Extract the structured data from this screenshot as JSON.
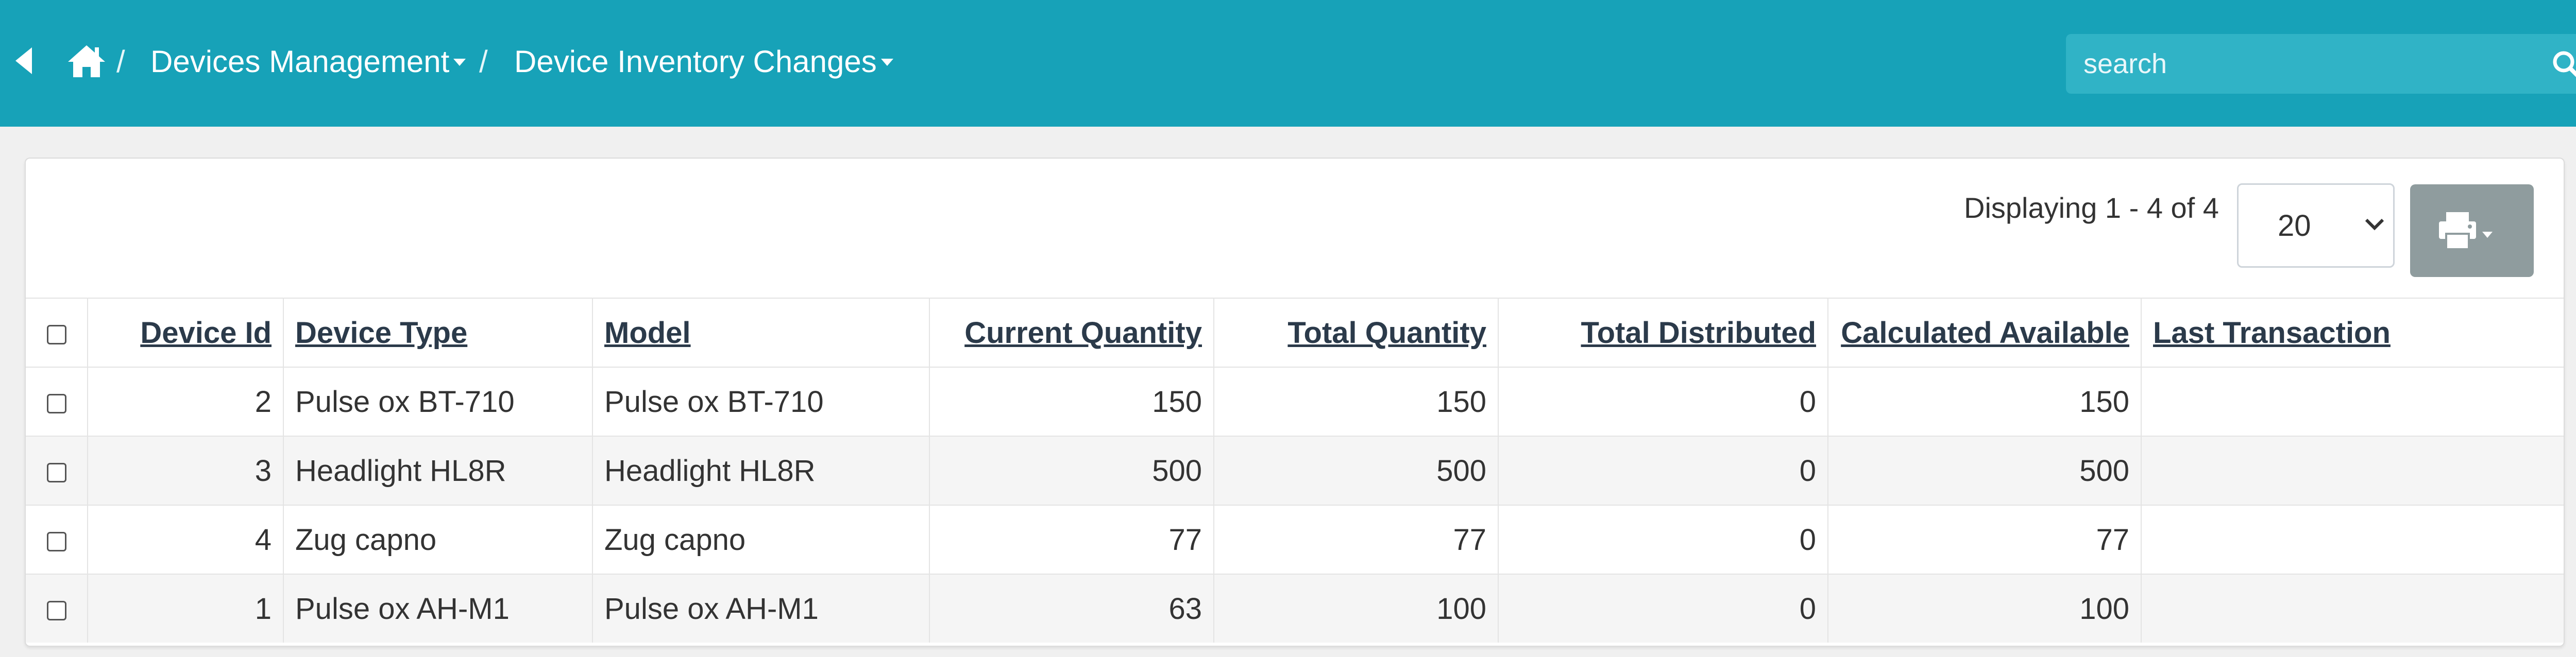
{
  "header": {
    "breadcrumb": {
      "home_icon": "home-icon",
      "items": [
        {
          "label": "Devices Management"
        },
        {
          "label": "Device Inventory Changes"
        }
      ],
      "separator": "/"
    },
    "search": {
      "placeholder": "search",
      "icon": "search-icon"
    },
    "colors": {
      "bar": "#17a2b8"
    }
  },
  "toolbar": {
    "displaying": "Displaying 1 - 4 of 4",
    "page_size": "20",
    "print_icon": "print-icon"
  },
  "table": {
    "columns": [
      "Device Id",
      "Device Type",
      "Model",
      "Current Quantity",
      "Total Quantity",
      "Total Distributed",
      "Calculated Available",
      "Last Transaction"
    ],
    "rows": [
      {
        "id": "2",
        "type": "Pulse ox BT-710",
        "model": "Pulse ox BT-710",
        "current": "150",
        "total": "150",
        "distributed": "0",
        "available": "150",
        "last": ""
      },
      {
        "id": "3",
        "type": "Headlight HL8R",
        "model": "Headlight HL8R",
        "current": "500",
        "total": "500",
        "distributed": "0",
        "available": "500",
        "last": ""
      },
      {
        "id": "4",
        "type": "Zug capno",
        "model": "Zug capno",
        "current": "77",
        "total": "77",
        "distributed": "0",
        "available": "77",
        "last": ""
      },
      {
        "id": "1",
        "type": "Pulse ox AH-M1",
        "model": "Pulse ox AH-M1",
        "current": "63",
        "total": "100",
        "distributed": "0",
        "available": "100",
        "last": ""
      }
    ]
  }
}
